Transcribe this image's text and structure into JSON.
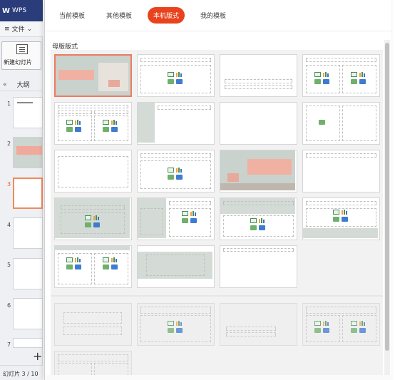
{
  "app": {
    "logo": "W",
    "name": "WPS"
  },
  "menu": {
    "file": "文件",
    "icon": "hamburger-icon"
  },
  "new_slide": {
    "label": "新建幻灯片"
  },
  "pane": {
    "outline": "大纲"
  },
  "slides": [
    "1",
    "2",
    "3",
    "4",
    "5",
    "6",
    "7"
  ],
  "status": {
    "text": "幻灯片 3 / 10"
  },
  "tabs": [
    {
      "label": "当前模板",
      "active": false
    },
    {
      "label": "其他模板",
      "active": false
    },
    {
      "label": "本机版式",
      "active": true
    },
    {
      "label": "我的模板",
      "active": false
    }
  ],
  "section": {
    "title": "母版版式"
  },
  "colors": {
    "accent": "#e8431e",
    "selection": "#f07a60",
    "titlebar": "#2a3d7a",
    "sage": "#d4dbd6",
    "pink": "#f0b1a2"
  }
}
